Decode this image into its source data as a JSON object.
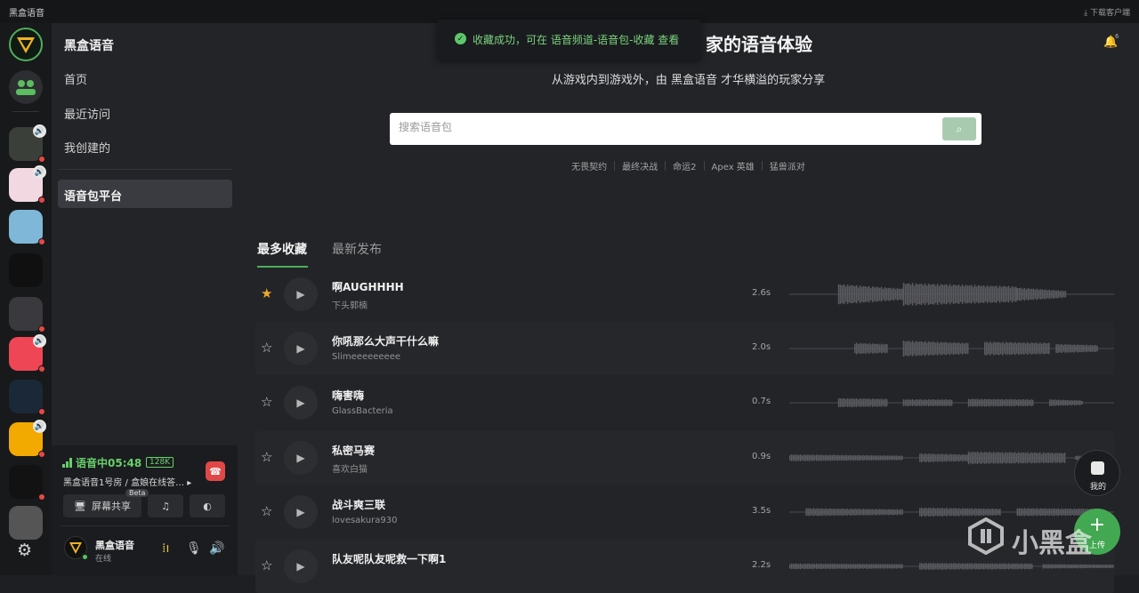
{
  "titlebar": {
    "app_title": "黑盒语音",
    "download": "⤓ 下载客户端"
  },
  "rail": {
    "items": [
      {
        "name": "heybox-logo",
        "color": "#f0b323"
      },
      {
        "name": "friends-icon",
        "color": "#5bbd5f"
      },
      {
        "name": "genshin-icon",
        "color": "#3b3f3a",
        "badge": "🔊",
        "dot": true
      },
      {
        "name": "anime-icon",
        "color": "#f2d8e0",
        "badge": "🔊",
        "dot": true
      },
      {
        "name": "palworld-icon",
        "color": "#7eb7d8",
        "dot": true
      },
      {
        "name": "heybox-icon",
        "color": "#101010"
      },
      {
        "name": "destiny-icon",
        "color": "#3a3a3e",
        "dot": true
      },
      {
        "name": "valorant-icon",
        "color": "#ef4655",
        "badge": "🔊",
        "dot": true
      },
      {
        "name": "steam-icon",
        "color": "#1b2838",
        "dot": true
      },
      {
        "name": "pubg-icon",
        "color": "#f2a900",
        "badge": "🔊",
        "dot": true
      },
      {
        "name": "cat-icon",
        "color": "#121212",
        "dot": true
      },
      {
        "name": "cloud-icon",
        "color": "#555",
        "dot": false
      }
    ]
  },
  "sidebar": {
    "title": "黑盒语音",
    "items": [
      "首页",
      "最近访问",
      "我创建的"
    ],
    "active_item": "语音包平台"
  },
  "voice": {
    "status": "语音中05:48",
    "bitrate": "128K",
    "room": "黑盒语音1号房 / 盒娘在线答…",
    "screen_share": "屏幕共享",
    "beta": "Beta",
    "user_name": "黑盒语音",
    "user_status": "在线"
  },
  "main": {
    "toast": "收藏成功，可在 语音频道-语音包-收藏 查看",
    "hero_title": "家的语音体验",
    "hero_subtitle": "从游戏内到游戏外，由 黑盒语音 才华横溢的玩家分享",
    "notification_count": "6",
    "search_placeholder": "搜索语音包",
    "tags": [
      "无畏契约",
      "最终决战",
      "命运2",
      "Apex 英雄",
      "猛兽派对"
    ],
    "tab_active": "最多收藏",
    "tab_inactive": "最新发布"
  },
  "clips": [
    {
      "title": "啊AUGHHHH",
      "author": "下头郭楠",
      "duration": "2.6s",
      "favorited": true
    },
    {
      "title": "你吼那么大声干什么嘛",
      "author": "Slimeeeeeeeee",
      "duration": "2.0s",
      "favorited": false
    },
    {
      "title": "嗨害嗨",
      "author": "GlassBacteria",
      "duration": "0.7s",
      "favorited": false
    },
    {
      "title": "私密马赛",
      "author": "喜欢白猫",
      "duration": "0.9s",
      "favorited": false
    },
    {
      "title": "战斗爽三联",
      "author": "lovesakura930",
      "duration": "3.5s",
      "favorited": false
    },
    {
      "title": "队友呢队友呢救一下啊1",
      "author": "",
      "duration": "2.2s",
      "favorited": false
    }
  ],
  "fab": {
    "mine": "我的",
    "upload": "上传"
  },
  "watermark": "小黑盒"
}
